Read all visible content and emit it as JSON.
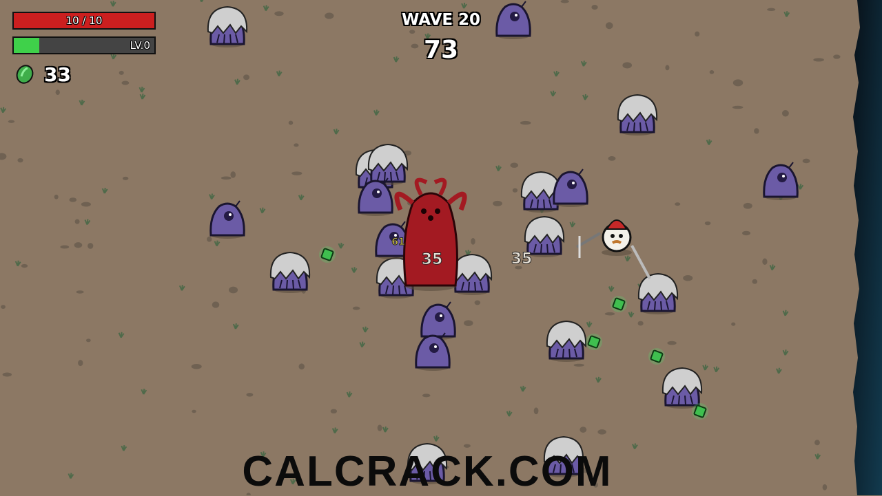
{
  "hud": {
    "hp_text": "10 / 10",
    "hp_fraction": 1.0,
    "hp_color": "#cc1f1f",
    "xp_text": "LV.0",
    "xp_fraction": 0.18,
    "xp_color": "#3fd14a",
    "materials_count": "33",
    "materials_icon": "green-material-icon"
  },
  "wave": {
    "title": "WAVE 20",
    "timer": "73"
  },
  "damage_numbers": [
    "35",
    "35",
    "61"
  ],
  "watermark": "CALCRACK.COM",
  "colors": {
    "ground": "#8c7864",
    "enemy_body": "#6b5ba6",
    "enemy_helmet": "#cfcfcf",
    "boss": "#a31a22",
    "material": "#4fe06a",
    "void_edge": "#0f2230"
  }
}
